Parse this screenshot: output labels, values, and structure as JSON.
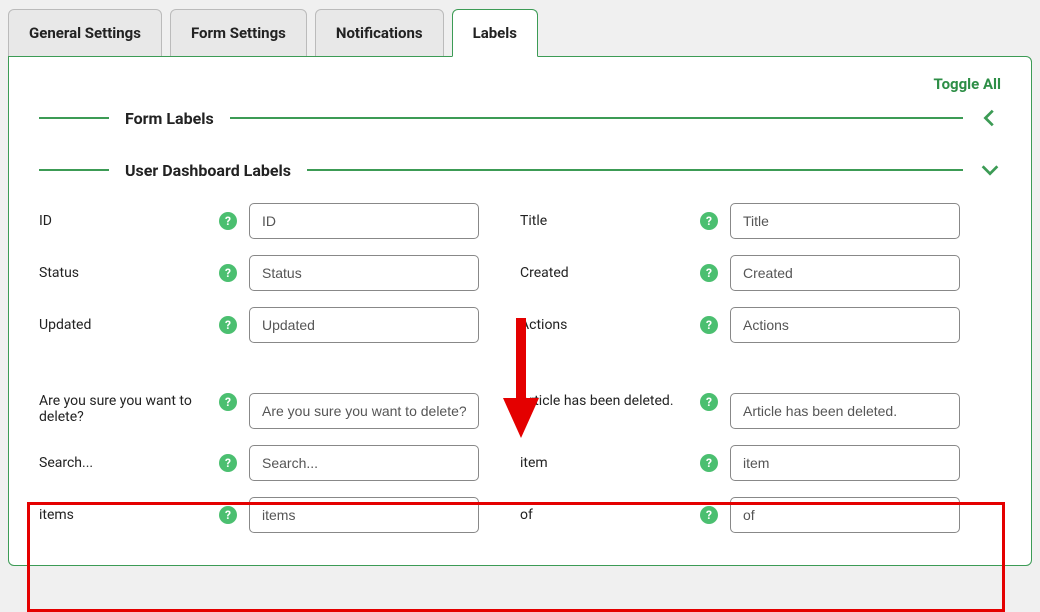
{
  "tabs": {
    "general": "General Settings",
    "form": "Form Settings",
    "notifications": "Notifications",
    "labels": "Labels"
  },
  "toggle_all": "Toggle All",
  "sections": {
    "form_labels": "Form Labels",
    "user_dashboard_labels": "User Dashboard Labels"
  },
  "fields": {
    "id": {
      "label": "ID",
      "value": "ID"
    },
    "title": {
      "label": "Title",
      "value": "Title"
    },
    "status": {
      "label": "Status",
      "value": "Status"
    },
    "created": {
      "label": "Created",
      "value": "Created"
    },
    "updated": {
      "label": "Updated",
      "value": "Updated"
    },
    "actions": {
      "label": "Actions",
      "value": "Actions"
    },
    "confirm_delete": {
      "label": "Are you sure you want to delete?",
      "value": "Are you sure you want to delete?"
    },
    "deleted": {
      "label": "Article has been deleted.",
      "value": "Article has been deleted."
    },
    "search": {
      "label": "Search...",
      "value": "Search..."
    },
    "item": {
      "label": "item",
      "value": "item"
    },
    "items": {
      "label": "items",
      "value": "items"
    },
    "of": {
      "label": "of",
      "value": "of"
    }
  },
  "help_glyph": "?"
}
